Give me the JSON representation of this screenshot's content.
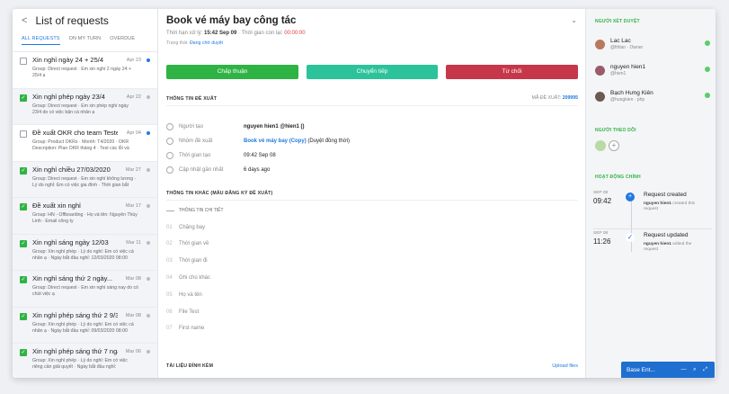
{
  "left": {
    "title": "List of requests",
    "tabs": [
      "ALL REQUESTS",
      "ON MY TURN",
      "OVERDUE"
    ],
    "items": [
      {
        "title": "Xin nghỉ ngày 24 + 25/4",
        "date": "Apr 23",
        "desc": "Group: Direct request · Em xin nghỉ 2 ngày 24 + 25/4 ạ",
        "checked": false
      },
      {
        "title": "Xin nghỉ phép ngày 23/4",
        "date": "Apr 22",
        "desc": "Group: Direct request · Em xin phép nghỉ ngày 23/4 do có việc bận cá nhân ạ",
        "checked": true
      },
      {
        "title": "Đề xuất OKR cho team Tester...",
        "date": "Apr 04",
        "desc": "Group: Product OKRs · Month: T4/2020 · OKR Description: Plan OKR tháng 4 · Test các lỗi và tìm...",
        "checked": false
      },
      {
        "title": "Xin nghỉ chiều 27/03/2020",
        "date": "Mar 27",
        "desc": "Group: Direct request · Em xin nghỉ không lương · Lý do nghỉ: Em có việc gia đình · Thời gian bắt đầu: 27/03/2020 13:00",
        "checked": true
      },
      {
        "title": "Đề xuất xin nghỉ",
        "date": "Mar 17",
        "desc": "Group: HN - Offboarding · Họ và tên: Nguyễn Thùy Linh · Email công ty",
        "checked": true
      },
      {
        "title": "Xin nghỉ sáng ngày 12/03",
        "date": "Mar 11",
        "desc": "Group: Xin nghỉ phép · Lý do nghỉ: Em có việc cá nhân ạ · Ngày bắt đầu nghỉ: 12/03/2020 08:00",
        "checked": true
      },
      {
        "title": "Xin nghỉ sáng thứ 2 ngày...",
        "date": "Mar 08",
        "desc": "Group: Direct request · Em xin nghỉ sáng nay do có chút việc ạ",
        "checked": true
      },
      {
        "title": "Xin nghỉ phép sáng thứ 2 9/3",
        "date": "Mar 08",
        "desc": "Group: Xin nghỉ phép · Lý do nghỉ: Em có việc cá nhân ạ · Ngày bắt đầu nghỉ: 09/03/2020 08:00",
        "checked": true
      },
      {
        "title": "Xin nghỉ phép sáng thứ 7 ngày...",
        "date": "Mar 06",
        "desc": "Group: Xin nghỉ phép · Lý do nghỉ: Em có việc riêng cần giải quyết · Ngày bắt đầu nghỉ: 07/03/2020 08:00",
        "checked": true
      }
    ]
  },
  "main": {
    "title": "Book vé máy bay công tác",
    "deadline_label": "Thời hạn xử lý:",
    "deadline": "15:42 Sep 09",
    "remaining_label": "· Thời gian còn lại:",
    "remaining": "00:00:00",
    "status_label": "Trạng thái:",
    "status": "Đang chờ duyệt",
    "approve": "Chấp thuận",
    "forward": "Chuyển tiếp",
    "reject": "Từ chối",
    "info_title": "THÔNG TIN ĐỀ XUẤT",
    "code_label": "MÃ ĐỀ XUẤT:",
    "code": "209995",
    "fields": [
      {
        "label": "Người tạo",
        "value": "nguyen hien1 @hien1 ()"
      },
      {
        "label": "Nhóm đề xuất",
        "link": "Book vé máy bay (Copy)",
        "extra": "(Duyệt đồng thời)"
      },
      {
        "label": "Thời gian tạo",
        "value": "09:42 Sep 08"
      },
      {
        "label": "Cập nhật gần nhất",
        "value": "6 days ago"
      }
    ],
    "other_title": "THÔNG TIN KHÁC (MẪU ĐĂNG KÝ ĐỀ XUẤT)",
    "detail_title": "THÔNG TIN CHI TIẾT",
    "other_rows": [
      {
        "n": "01",
        "label": "Chặng bay"
      },
      {
        "n": "02",
        "label": "Thời gian về"
      },
      {
        "n": "03",
        "label": "Thời gian đi"
      },
      {
        "n": "04",
        "label": "Ghi chú khác"
      },
      {
        "n": "05",
        "label": "Họ và tên"
      },
      {
        "n": "06",
        "label": "File Test"
      },
      {
        "n": "07",
        "label": "First name"
      }
    ],
    "attach_title": "TÀI LIỆU ĐÍNH KÈM",
    "upload": "Upload files"
  },
  "right": {
    "approvers_title": "NGƯỜI XÉT DUYỆT",
    "approvers": [
      {
        "name": "Lac Lac",
        "role": "@lthlan · Owner"
      },
      {
        "name": "nguyen hien1",
        "role": "@hien1"
      },
      {
        "name": "Bạch Hưng Kiên",
        "role": "@hungkien · php"
      }
    ],
    "followers_title": "NGƯỜI THEO DÕI",
    "activity_title": "HOẠT ĐỘNG CHÍNH",
    "activities": [
      {
        "date": "SEP 08",
        "time": "09:42",
        "title": "Request created",
        "user": "nguyen hien1",
        "text": "created this request"
      },
      {
        "date": "SEP 08",
        "time": "11:26",
        "title": "Request updated",
        "user": "nguyen hien1",
        "text": "edited the request"
      }
    ]
  },
  "base": {
    "label": "Base Ent..."
  }
}
